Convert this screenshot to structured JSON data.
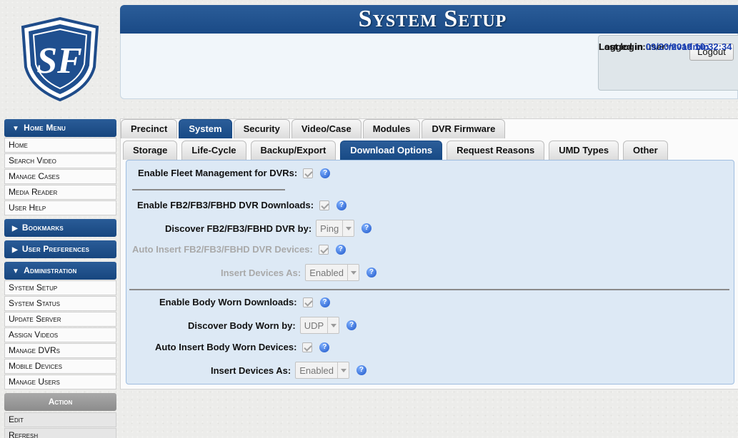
{
  "header": {
    "title": "System Setup",
    "logged_in_label": "Logged in user:",
    "logged_in_user": "mvadmin",
    "last_login_label": "Last login:",
    "last_login_value": "09/20/2019 10:32:34",
    "logout_label": "Logout"
  },
  "logo": {
    "text": "SF",
    "icon": "shield-logo"
  },
  "sidebar": {
    "home_menu": "Home Menu",
    "home_items": [
      "Home",
      "Search Video",
      "Manage Cases",
      "Media Reader",
      "User Help"
    ],
    "bookmarks": "Bookmarks",
    "user_preferences": "User Preferences",
    "administration": "Administration",
    "admin_items": [
      "System Setup",
      "System Status",
      "Update Server",
      "Assign Videos",
      "Manage DVRs",
      "Mobile Devices",
      "Manage Users"
    ],
    "action": "Action",
    "action_items": [
      "Edit",
      "Refresh"
    ]
  },
  "tabs_primary": [
    "Precinct",
    "System",
    "Security",
    "Video/Case",
    "Modules",
    "DVR Firmware"
  ],
  "tabs_primary_active": "System",
  "tabs_secondary": [
    "Storage",
    "Life-Cycle",
    "Backup/Export",
    "Download Options",
    "Request Reasons",
    "UMD Types",
    "Other"
  ],
  "tabs_secondary_active": "Download Options",
  "form": {
    "fleet_mgmt": "Enable Fleet Management for DVRs:",
    "fb_downloads": "Enable FB2/FB3/FBHD DVR Downloads:",
    "fb_discover": "Discover FB2/FB3/FBHD DVR by:",
    "fb_discover_value": "Ping",
    "fb_auto_insert": "Auto Insert FB2/FB3/FBHD DVR Devices:",
    "fb_insert_as": "Insert Devices As:",
    "fb_insert_as_value": "Enabled",
    "bw_downloads": "Enable Body Worn Downloads:",
    "bw_discover": "Discover Body Worn by:",
    "bw_discover_value": "UDP",
    "bw_auto_insert": "Auto Insert Body Worn Devices:",
    "bw_insert_as": "Insert Devices As:",
    "bw_insert_as_value": "Enabled",
    "help_glyph": "?"
  },
  "colors": {
    "brand_blue": "#1f5190",
    "panel_bg": "#dde9f5",
    "link_blue": "#1a3fb0"
  }
}
